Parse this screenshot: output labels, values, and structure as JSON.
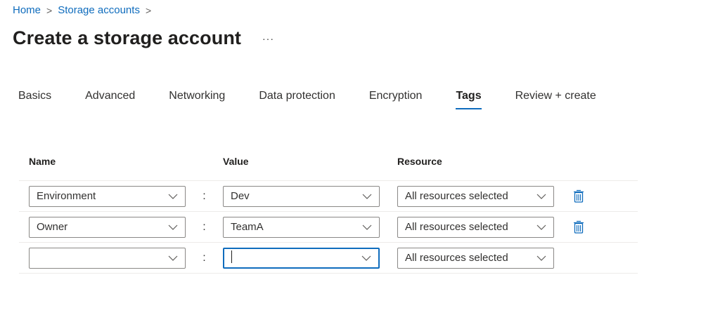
{
  "breadcrumb": {
    "home": "Home",
    "storage_accounts": "Storage accounts",
    "separator": ">"
  },
  "page": {
    "title": "Create a storage account",
    "more_label": "···"
  },
  "tabs": [
    {
      "label": "Basics"
    },
    {
      "label": "Advanced"
    },
    {
      "label": "Networking"
    },
    {
      "label": "Data protection"
    },
    {
      "label": "Encryption"
    },
    {
      "label": "Tags",
      "active": true
    },
    {
      "label": "Review + create"
    }
  ],
  "table": {
    "headers": {
      "name": "Name",
      "value": "Value",
      "resource": "Resource"
    },
    "separator": ":",
    "rows": [
      {
        "name": "Environment",
        "value": "Dev",
        "resource": "All resources selected"
      },
      {
        "name": "Owner",
        "value": "TeamA",
        "resource": "All resources selected"
      },
      {
        "name": "",
        "value": "",
        "resource": "All resources selected"
      }
    ]
  },
  "colors": {
    "accent": "#0f6cbd",
    "border": "#8a8886",
    "divider": "#edebe9"
  },
  "icons": {
    "chevron": "chevron-down-icon",
    "delete": "trash-icon"
  }
}
